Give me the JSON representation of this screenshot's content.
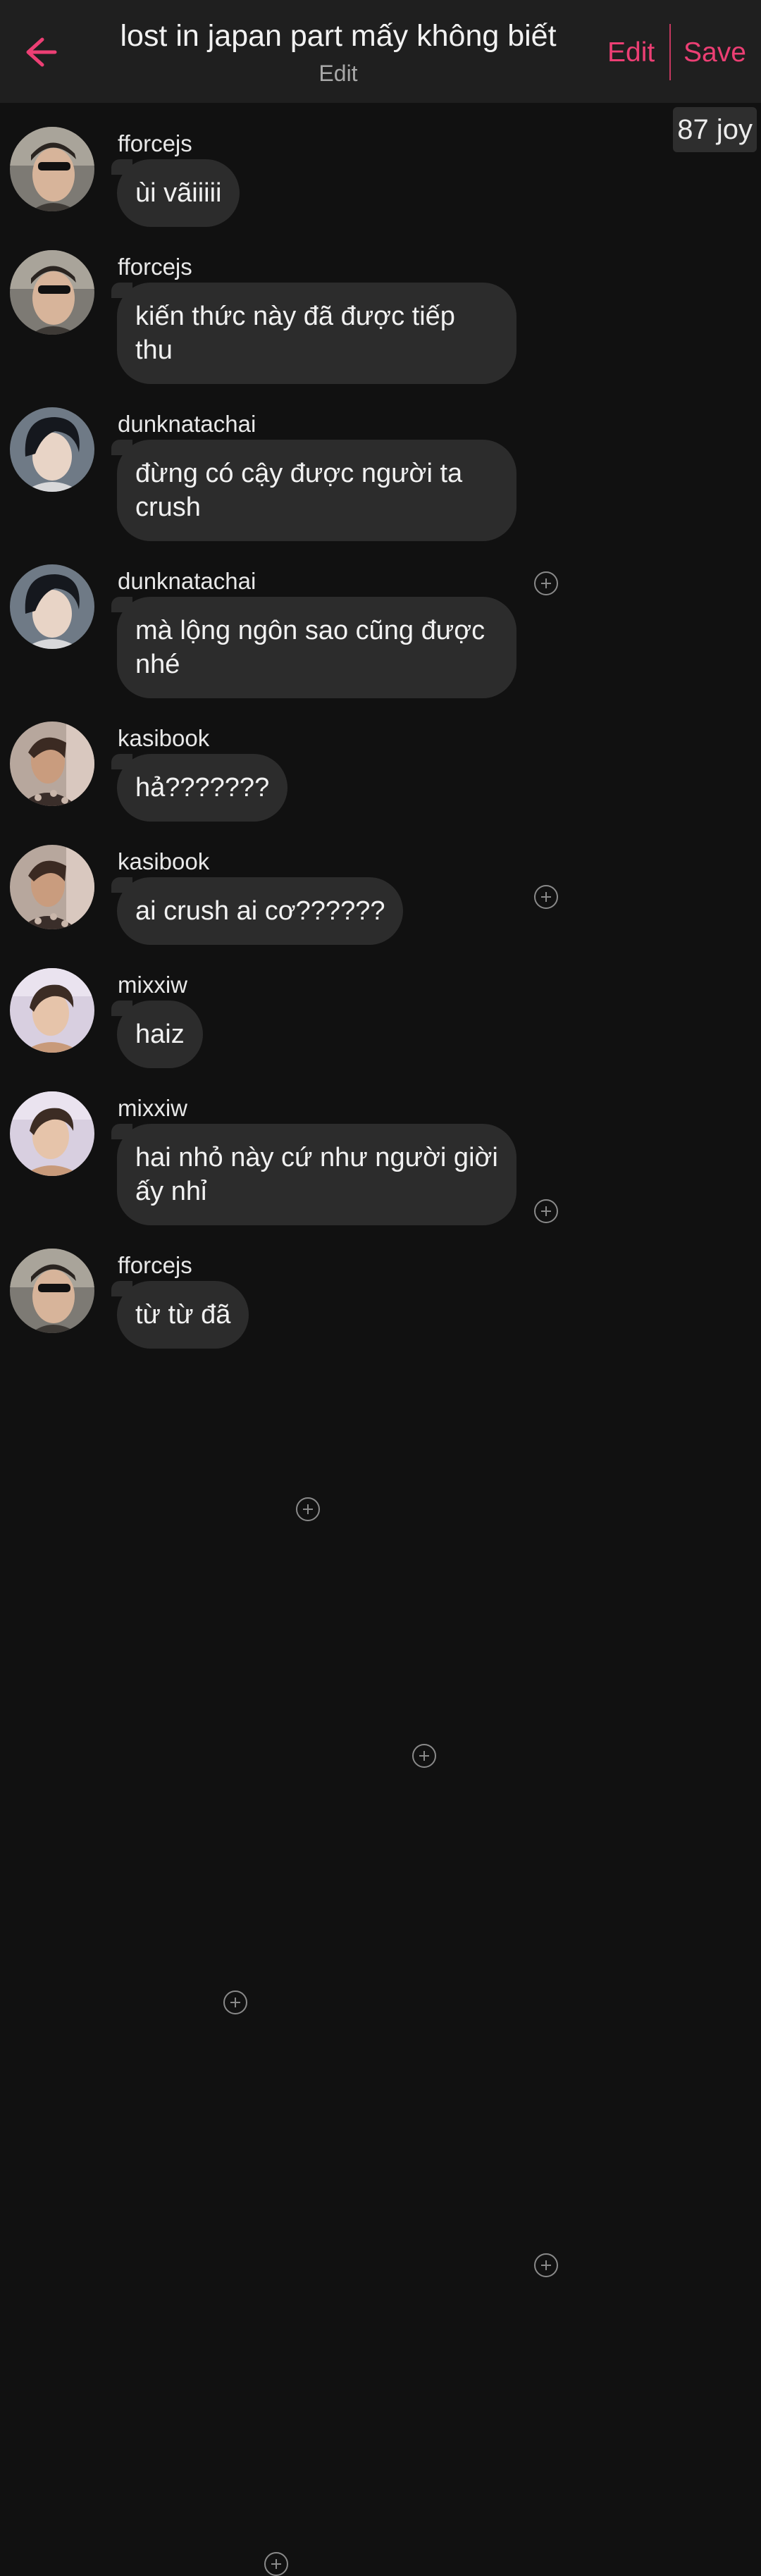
{
  "header": {
    "title": "lost in japan part mấy không biết",
    "subtitle": "Edit",
    "edit_label": "Edit",
    "save_label": "Save",
    "back_icon": "arrow-left-icon",
    "accent_color": "#ec3f74"
  },
  "badge": {
    "text": "87 joy"
  },
  "messages": [
    {
      "username": "fforcejs",
      "text": "ùi vãiiiii"
    },
    {
      "username": "fforcejs",
      "text": "kiến thức này đã được tiếp thu"
    },
    {
      "username": "dunknatachai",
      "text": "đừng có cậy được người ta crush"
    },
    {
      "username": "dunknatachai",
      "text": "mà lộng ngôn sao cũng được nhé"
    },
    {
      "username": "kasibook",
      "text": "hả???????"
    },
    {
      "username": "kasibook",
      "text": "ai crush ai cơ??????"
    },
    {
      "username": "mixxiw",
      "text": "haiz"
    },
    {
      "username": "mixxiw",
      "text": "hai nhỏ này cứ như người giời ấy nhỉ"
    },
    {
      "username": "fforcejs",
      "text": "từ từ đã"
    }
  ]
}
